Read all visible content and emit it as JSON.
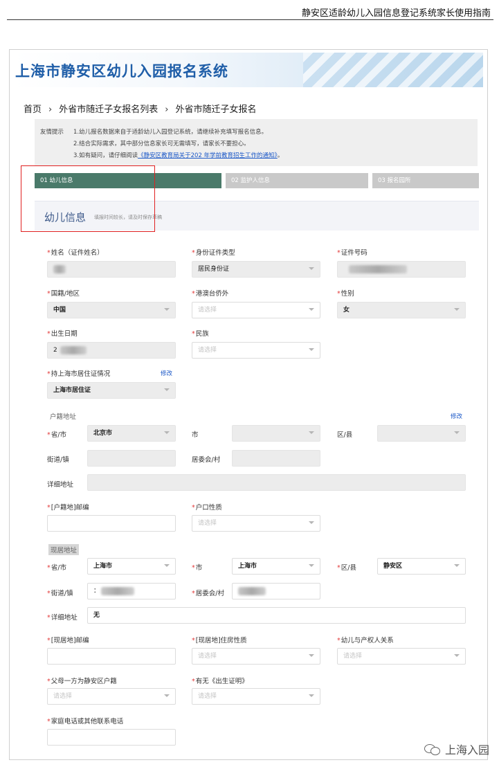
{
  "doc_title": "静安区适龄幼儿入园信息登记系统家长使用指南",
  "banner_title": "上海市静安区幼儿入园报名系统",
  "breadcrumb": [
    "首页",
    "外省市随迁子女报名列表",
    "外省市随迁子女报名"
  ],
  "breadcrumb_sep": "›",
  "notice": {
    "label": "友情提示",
    "line1": "1.幼儿报名数据来自于适龄幼儿入园登记系统，请继续补充填写报名信息。",
    "line2": "2.结合实际需求，其中部分信息家长可无需填写，请家长不要担心。",
    "line3_prefix": "3.如有疑问，请仔细阅读",
    "line3_link": "《静安区教育局关于202  年学前教育招生工作的通知》",
    "line3_suffix": "。"
  },
  "steps": [
    "01 幼儿信息",
    "02 监护人信息",
    "03 报名园所"
  ],
  "section": {
    "title": "幼儿信息",
    "subtitle": "填报时间较长，请及时保存草稿"
  },
  "placeholder": "请选择",
  "edit_label": "修改",
  "fields": {
    "name": {
      "label": "姓名（证件姓名）"
    },
    "id_type": {
      "label": "身份证件类型",
      "value": "居民身份证"
    },
    "id_no": {
      "label": "证件号码"
    },
    "nationality": {
      "label": "国籍/地区",
      "value": "中国"
    },
    "hk_macau": {
      "label": "港澳台侨外"
    },
    "gender": {
      "label": "性别",
      "value": "女"
    },
    "birth": {
      "label": "出生日期",
      "value_prefix": "2"
    },
    "ethnicity": {
      "label": "民族"
    },
    "residence_permit": {
      "label": "持上海市居住证情况",
      "value": "上海市居住证"
    },
    "hukou_group": "户籍地址",
    "hukou_prov": {
      "label": "省/市",
      "value": "北京市"
    },
    "hukou_city": {
      "label": "市"
    },
    "hukou_district": {
      "label": "区/县"
    },
    "hukou_street": {
      "label": "街道/镇"
    },
    "hukou_committee": {
      "label": "居委会/村"
    },
    "hukou_detail": {
      "label": "详细地址"
    },
    "hukou_zip": {
      "label": "[户籍地]邮编"
    },
    "hukou_nature": {
      "label": "户口性质"
    },
    "current_group": "现居地址",
    "cur_prov": {
      "label": "省/市",
      "value": "上海市"
    },
    "cur_city": {
      "label": "市",
      "value": "上海市"
    },
    "cur_district": {
      "label": "区/县",
      "value": "静安区"
    },
    "cur_street": {
      "label": "街道/镇",
      "value_prefix": "："
    },
    "cur_committee": {
      "label": "居委会/村"
    },
    "cur_detail": {
      "label": "详细地址",
      "value": "无"
    },
    "cur_zip": {
      "label": "[现居地]邮编"
    },
    "cur_housing": {
      "label": "[现居地]住房性质"
    },
    "relation": {
      "label": "幼儿与产权人关系"
    },
    "parent_hukou": {
      "label": "父母一方为静安区户籍"
    },
    "birth_cert": {
      "label": "有无《出生证明》"
    },
    "phone": {
      "label": "家庭电话或其他联系电话"
    }
  },
  "watermark": "上海入园"
}
